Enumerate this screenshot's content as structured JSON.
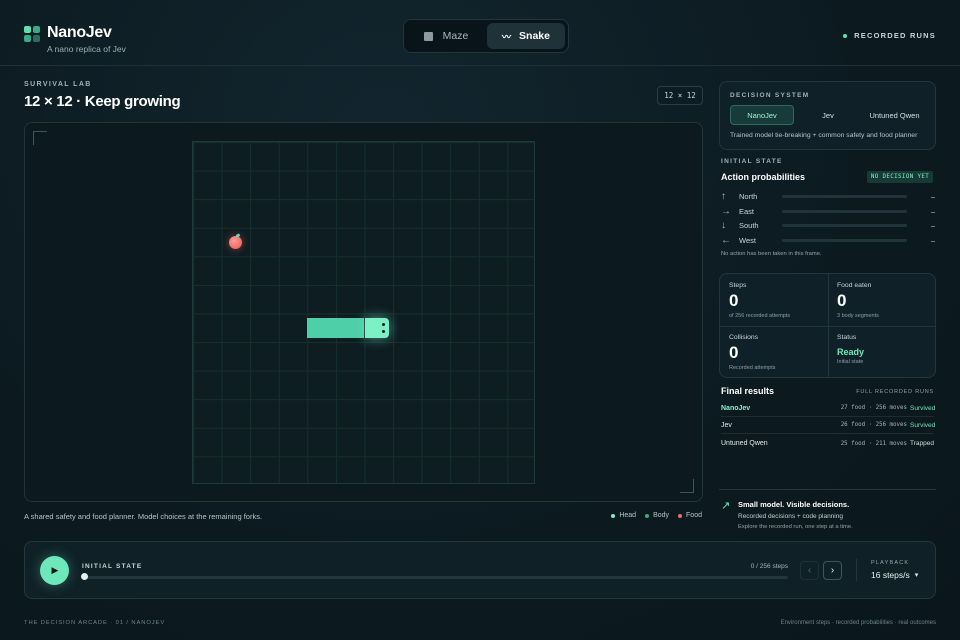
{
  "brand": {
    "title": "NanoJev",
    "subtitle": "A nano replica of Jev"
  },
  "modes": [
    {
      "label": "Maze",
      "active": false
    },
    {
      "label": "Snake",
      "active": true
    }
  ],
  "header": {
    "recorded_runs": "RECORDED RUNS"
  },
  "lab": {
    "kicker": "SURVIVAL LAB",
    "title": "12 × 12 · Keep growing",
    "size_badge": "12 × 12"
  },
  "board": {
    "grid_size": 12,
    "food": {
      "col": 1,
      "row": 3
    },
    "snake": {
      "body": [
        {
          "col": 4,
          "row": 6
        },
        {
          "col": 5,
          "row": 6
        }
      ],
      "head": {
        "col": 6,
        "row": 6
      }
    },
    "caption": "A shared safety and food planner. Model choices at the remaining forks.",
    "legend": [
      {
        "label": "Head",
        "color": "#7ef0c6"
      },
      {
        "label": "Body",
        "color": "#3aa988"
      },
      {
        "label": "Food",
        "color": "#f26b62"
      }
    ]
  },
  "decision": {
    "kicker": "DECISION SYSTEM",
    "options": [
      "NanoJev",
      "Jev",
      "Untuned Qwen"
    ],
    "active": "NanoJev",
    "note": "Trained model tie-breaking + common safety and food planner"
  },
  "probabilities": {
    "kicker": "INITIAL STATE",
    "title": "Action probabilities",
    "badge": "NO DECISION YET",
    "rows": [
      {
        "arrow": "↑",
        "label": "North",
        "value": "–"
      },
      {
        "arrow": "→",
        "label": "East",
        "value": "–"
      },
      {
        "arrow": "↓",
        "label": "South",
        "value": "–"
      },
      {
        "arrow": "←",
        "label": "West",
        "value": "–"
      }
    ],
    "note": "No action has been taken in this frame."
  },
  "stats": {
    "steps": {
      "label": "Steps",
      "value": "0",
      "sub": "of 256 recorded attempts"
    },
    "food": {
      "label": "Food eaten",
      "value": "0",
      "sub": "3 body segments"
    },
    "collisions": {
      "label": "Collisions",
      "value": "0",
      "sub": "Recorded attempts"
    },
    "status": {
      "label": "Status",
      "value": "Ready",
      "sub": "Initial state"
    }
  },
  "final": {
    "title": "Final results",
    "kicker": "FULL RECORDED RUNS",
    "rows": [
      {
        "name": "NanoJev",
        "moves": "27 food · 256 moves",
        "outcome": "Survived"
      },
      {
        "name": "Jev",
        "moves": "26 food · 256 moves",
        "outcome": "Survived"
      },
      {
        "name": "Untuned Qwen",
        "moves": "25 food · 211 moves",
        "outcome": "Trapped"
      }
    ]
  },
  "tagline": {
    "title": "Small model. Visible decisions.",
    "line2": "Recorded decisions + code planning",
    "line3": "Explore the recorded run, one step at a time."
  },
  "player": {
    "frame_label": "INITIAL STATE",
    "step_count": "0 / 256 steps",
    "progress": 0,
    "playback_kicker": "PLAYBACK",
    "speed": "16 steps/s"
  },
  "footer": {
    "left": "THE DECISION ARCADE · 01 / NANOJEV",
    "right": "Environment steps · recorded probabilities · real outcomes"
  }
}
